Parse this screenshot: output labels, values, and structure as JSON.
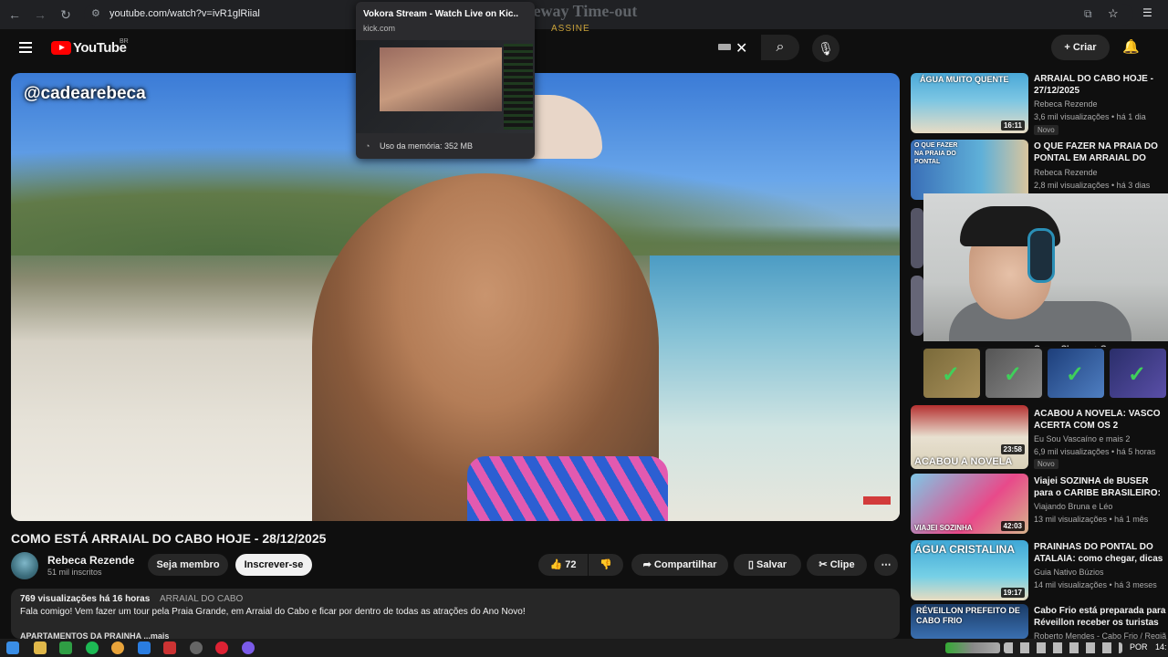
{
  "browser": {
    "url": "youtube.com/watch?v=ivR1glRiial",
    "ghost_text": "504 Gateway Time-out"
  },
  "tooltip": {
    "title": "Vokora Stream - Watch Live on Kic..",
    "domain": "kick.com",
    "memory": "Uso da memória: 352 MB"
  },
  "header": {
    "logo": "YouTube",
    "region": "BR",
    "assine": "ASSINE",
    "create_label": "Criar"
  },
  "video": {
    "watermark": "@cadearebeca",
    "title": "COMO ESTÁ ARRAIAL DO CABO HOJE - 28/12/2025",
    "channel": "Rebeca Rezende",
    "subscribers": "51 mil inscritos",
    "join_label": "Seja membro",
    "subscribe_label": "Inscrever-se",
    "likes": "72",
    "share_label": "Compartilhar",
    "save_label": "Salvar",
    "clip_label": "Clipe",
    "views_time": "769 visualizações  há 16 horas",
    "tag": "ARRAIAL DO CABO",
    "description": "Fala comigo! Vem fazer um tour pela Praia Grande, em Arraial do Cabo e ficar por dentro de todas as atrações do Ano Novo!",
    "more_text": "APARTAMENTOS DA PRAINHA ...mais"
  },
  "recommendations": [
    {
      "title": "ARRAIAL DO CABO HOJE - 27/12/2025",
      "channel": "Rebeca Rezende",
      "meta": "3,6 mil visualizações • há 1 dia",
      "badge": "Novo",
      "duration": "16:11",
      "caption": "ÁGUA MUITO QUENTE"
    },
    {
      "title": "O QUE FAZER NA PRAIA DO PONTAL EM ARRAIAL DO CABO",
      "channel": "Rebeca Rezende",
      "meta": "2,8 mil visualizações • há 3 dias",
      "caption": "O QUE FAZER NA PRAIA DO PONTAL"
    },
    {
      "title": "Grupo Cleroey + Grupo",
      "channel": "",
      "meta": ""
    },
    {
      "title": "ACABOU A NOVELA: VASCO ACERTA COM OS 2 PRIMEIRO...",
      "channel": "Eu Sou Vascaíno e mais 2",
      "meta": "6,9 mil visualizações • há 5 horas",
      "badge": "Novo",
      "duration": "23:58",
      "caption": "ACABOU A NOVELA"
    },
    {
      "title": "Viajei SOZINHA de BUSER para o CARIBE BRASILEIRO: É ...",
      "channel": "Viajando Bruna e Léo",
      "meta": "13 mil visualizações • há 1 mês",
      "duration": "42:03",
      "caption": "VIAJEI SOZINHA"
    },
    {
      "title": "PRAINHAS DO PONTAL DO ATALAIA: como chegar, dicas ...",
      "channel": "Guia Nativo Búzios",
      "meta": "14 mil visualizações • há 3 meses",
      "duration": "19:17",
      "caption": "ÁGUA CRISTALINA"
    },
    {
      "title": "Cabo Frio está preparada para Réveillon receber os turistas ...",
      "channel": "Roberto Mendes - Cabo Frio / Regiã",
      "meta": "",
      "caption": "RÉVEILLON PREFEITO DE CABO FRIO"
    }
  ],
  "taskbar": {
    "lang": "POR",
    "time": "14:"
  },
  "colors": {
    "accent": "#ff0000",
    "background": "#0f0f0f",
    "check": "#3fd05a"
  }
}
